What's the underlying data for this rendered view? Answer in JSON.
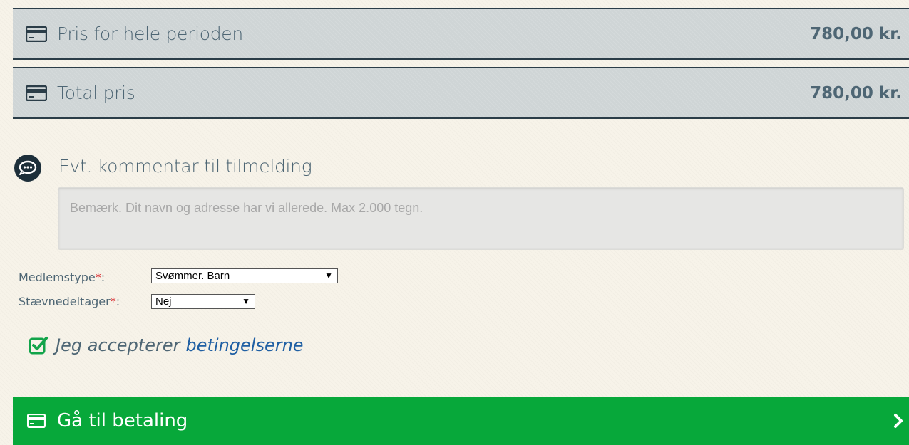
{
  "prices": {
    "period": {
      "label": "Pris for hele perioden",
      "amount": "780,00 kr.",
      "icon": "credit-card-icon"
    },
    "total": {
      "label": "Total pris",
      "amount": "780,00 kr.",
      "icon": "credit-card-icon"
    }
  },
  "comment": {
    "title": "Evt. kommentar til tilmelding",
    "placeholder": "Bemærk. Dit navn og adresse har vi allerede. Max 2.000 tegn.",
    "value": "",
    "icon": "comment-icon"
  },
  "fields": {
    "membership": {
      "label": "Medlemstype",
      "required_mark": "*",
      "suffix": ":",
      "value": "Svømmer. Barn"
    },
    "competitor": {
      "label": "Stævnedeltager",
      "required_mark": "*",
      "suffix": ":",
      "value": "Nej"
    }
  },
  "terms": {
    "checked": true,
    "text": "Jeg accepterer",
    "link": "betingelserne"
  },
  "pay": {
    "label": "Gå til betaling",
    "icon": "credit-card-icon"
  },
  "colors": {
    "accent_green": "#07a83a",
    "row_bg": "#cfd5d6",
    "text": "#4e6674",
    "link": "#1f5fa3",
    "required": "#d9262b"
  }
}
